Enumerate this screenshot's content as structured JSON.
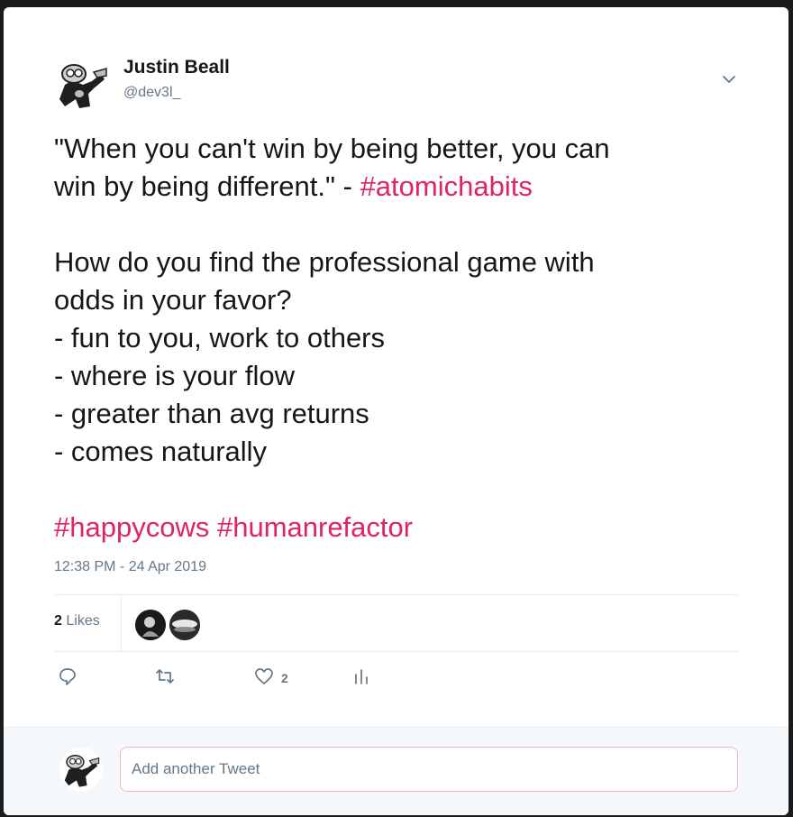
{
  "author": {
    "name": "Justin Beall",
    "handle": "@dev3l_"
  },
  "tweet": {
    "lines": [
      {
        "text": "\"When you can't win by being better, you can"
      },
      {
        "text": "win by being different.\" - ",
        "hashtag": "#atomichabits"
      },
      {
        "text": ""
      },
      {
        "text": "How do you find the professional game with"
      },
      {
        "text": "odds in your favor?"
      },
      {
        "text": "- fun to you, work to others"
      },
      {
        "text": "- where is your flow"
      },
      {
        "text": "- greater than avg returns"
      },
      {
        "text": "- comes naturally"
      },
      {
        "text": ""
      },
      {
        "hashtag": "#happycows",
        "hashtag2": "#humanrefactor"
      }
    ]
  },
  "timestamp": "12:38 PM - 24 Apr 2019",
  "likes": {
    "count": "2",
    "label": "Likes"
  },
  "actions": {
    "like_count": "2"
  },
  "reply": {
    "placeholder": "Add another Tweet"
  },
  "colors": {
    "hashtag": "#e0245e",
    "secondary_text": "#657786",
    "primary_text": "#14171a"
  },
  "icons": [
    "chevron-down-icon",
    "reply-icon",
    "retweet-icon",
    "heart-icon",
    "analytics-icon"
  ]
}
